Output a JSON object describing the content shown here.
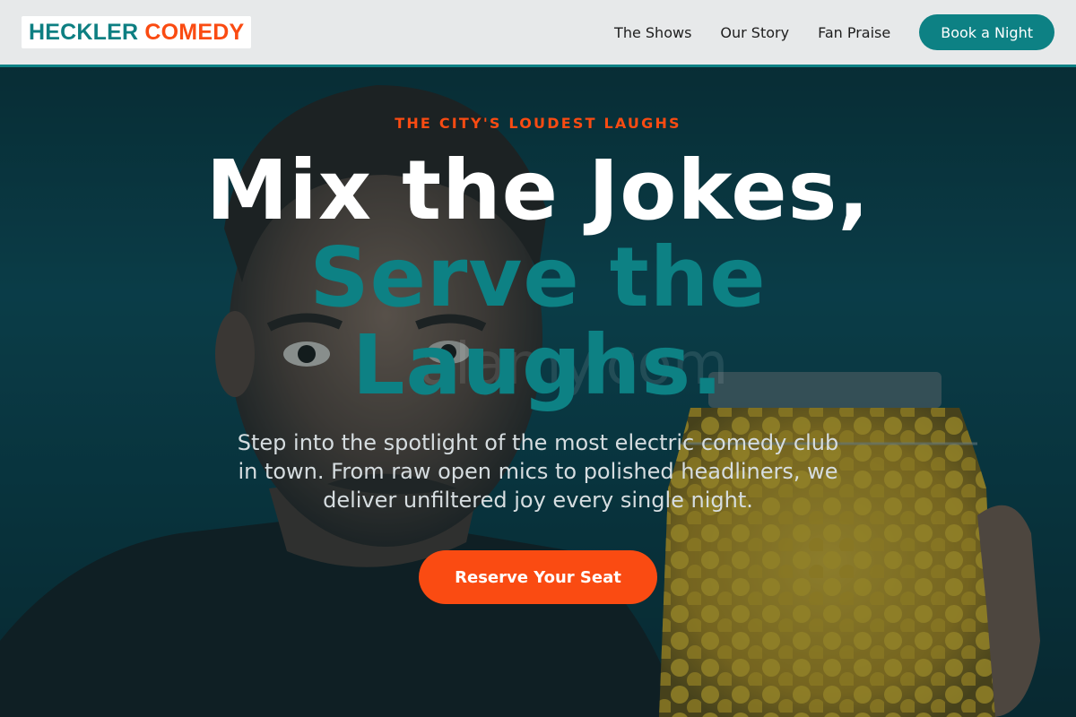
{
  "brand": {
    "logo_part_a": "HECKLER",
    "logo_part_b": "COMEDY",
    "primary_color": "#0d8184",
    "accent_color": "#fa4b12"
  },
  "nav": {
    "links": [
      "The Shows",
      "Our Story",
      "Fan Praise"
    ],
    "cta_label": "Book a Night"
  },
  "hero": {
    "eyebrow": "THE CITY'S LOUDEST LAUGHS",
    "headline_line1": "Mix the Jokes,",
    "headline_line2": "Serve the Laughs.",
    "watermark": "alamy.com",
    "subtext": "Step into the spotlight of the most electric comedy club in town. From raw open mics to polished headliners, we deliver unfiltered joy every single night.",
    "cta_label": "Reserve Your Seat",
    "background_image": "man-holding-jar-of-yellow-candy-photo"
  }
}
